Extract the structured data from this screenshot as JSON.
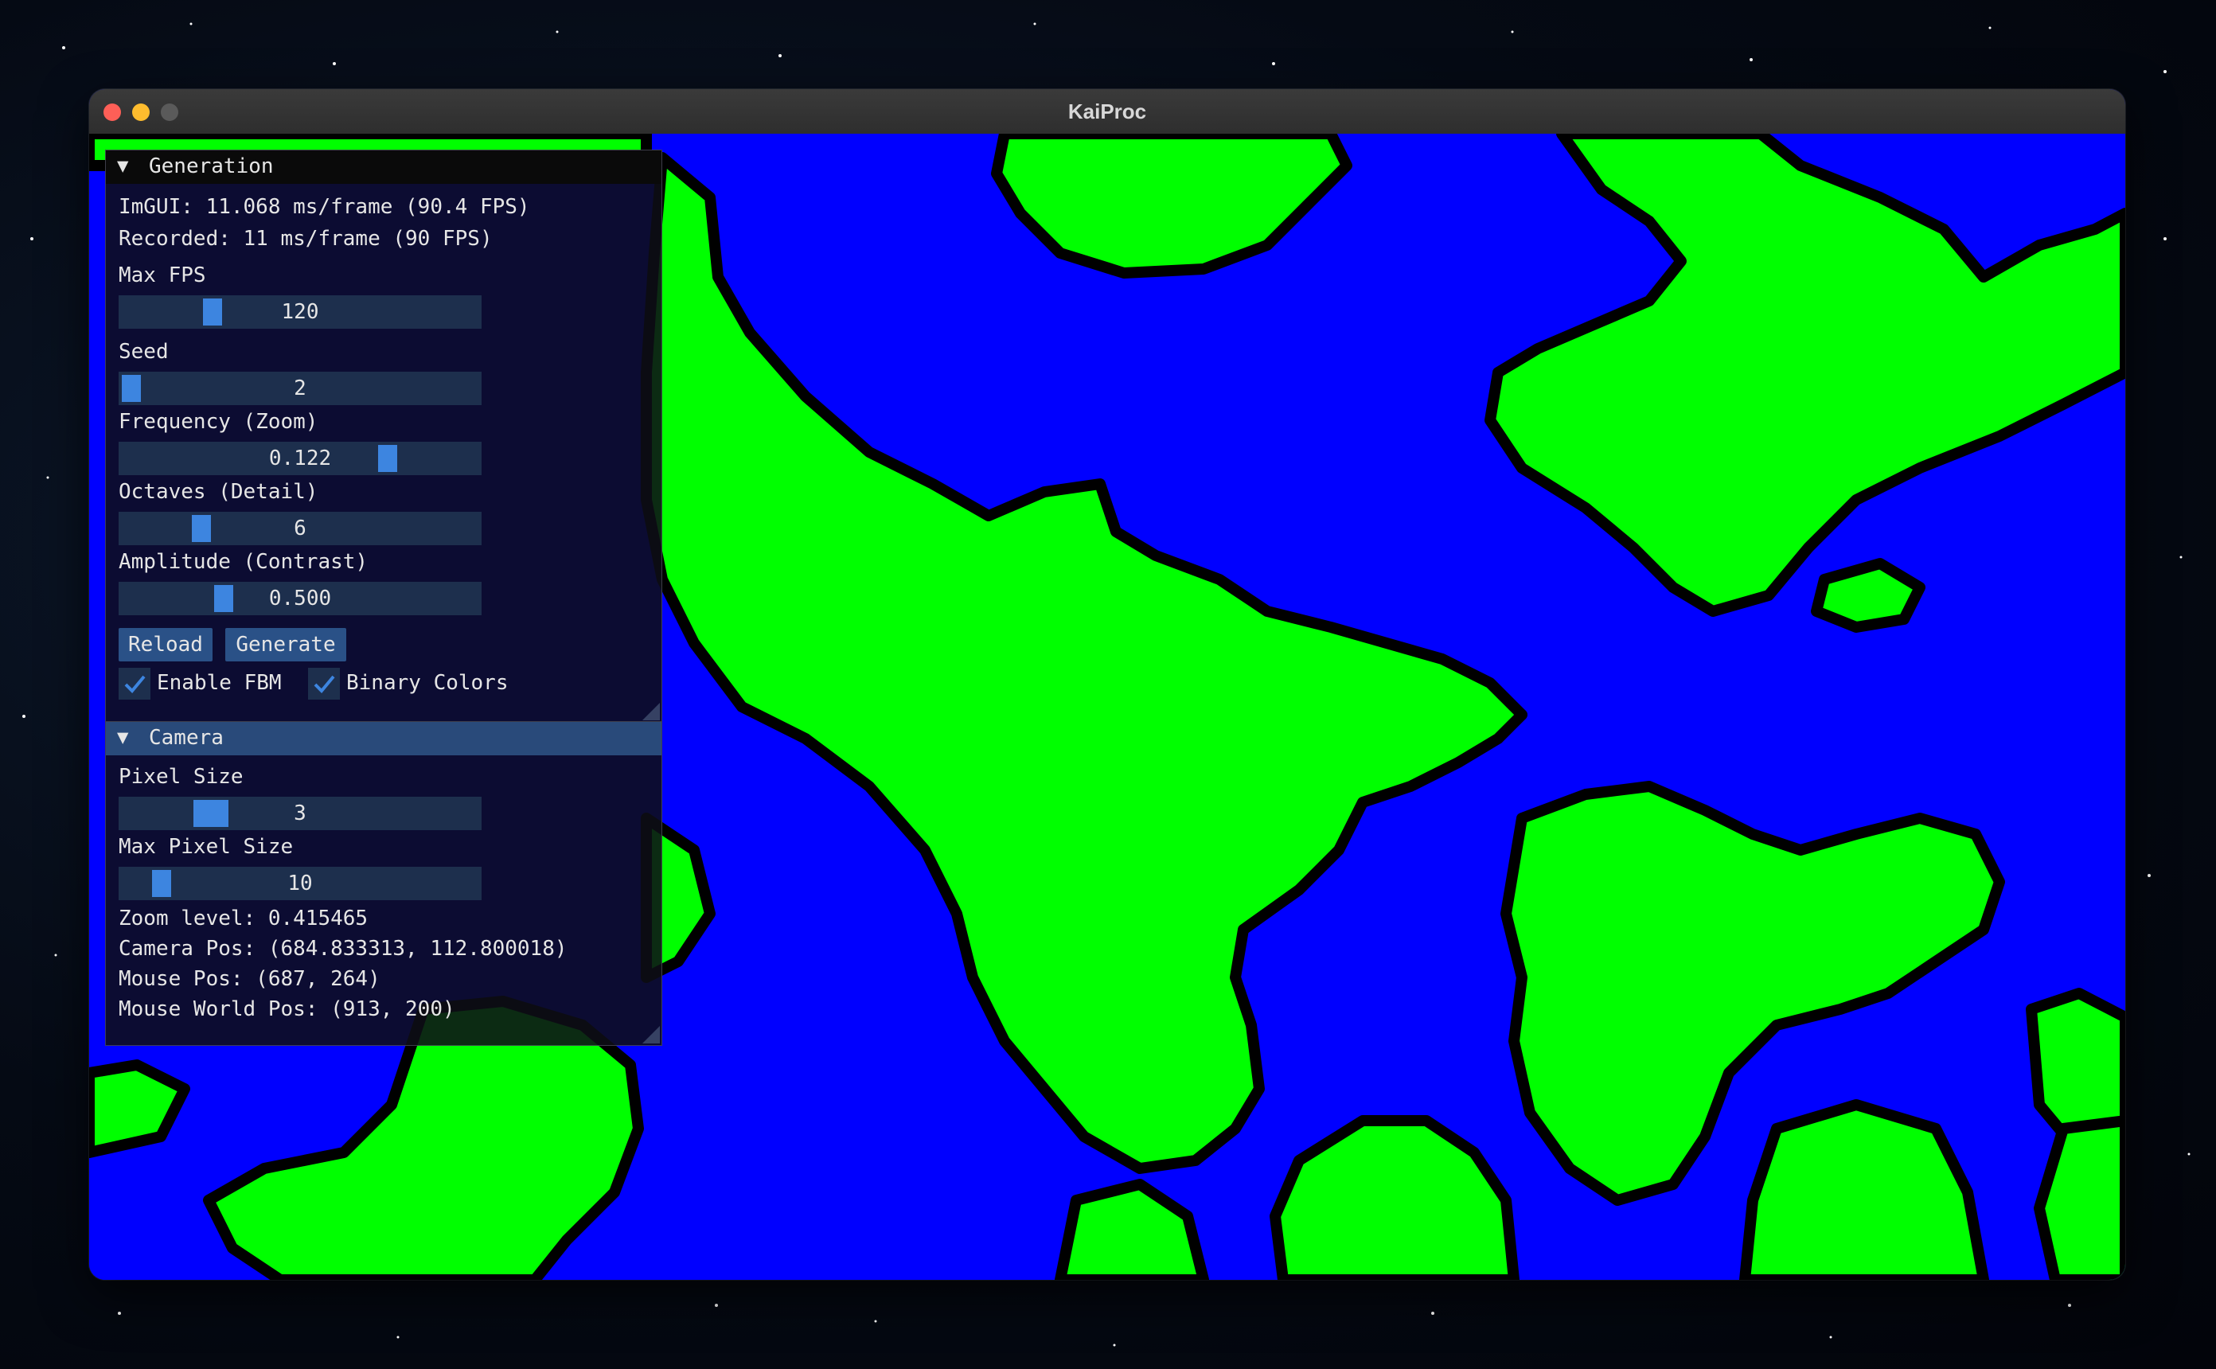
{
  "window": {
    "title": "KaiProc"
  },
  "generation": {
    "header": "Generation",
    "imgui_stat": "ImGUI: 11.068 ms/frame (90.4 FPS)",
    "recorded_stat": "Recorded: 11 ms/frame (90 FPS)",
    "max_fps": {
      "label": "Max FPS",
      "value": "120"
    },
    "seed": {
      "label": "Seed",
      "value": "2"
    },
    "frequency": {
      "label": "Frequency (Zoom)",
      "value": "0.122"
    },
    "octaves": {
      "label": "Octaves (Detail)",
      "value": "6"
    },
    "amplitude": {
      "label": "Amplitude (Contrast)",
      "value": "0.500"
    },
    "reload_label": "Reload",
    "generate_label": "Generate",
    "enable_fbm": {
      "label": "Enable FBM",
      "checked": true
    },
    "binary_colors": {
      "label": "Binary Colors",
      "checked": true
    }
  },
  "camera": {
    "header": "Camera",
    "pixel_size": {
      "label": "Pixel Size",
      "value": "3"
    },
    "max_pixel_size": {
      "label": "Max Pixel Size",
      "value": "10"
    },
    "zoom_level": "Zoom level: 0.415465",
    "camera_pos": "Camera Pos: (684.833313, 112.800018)",
    "mouse_pos": "Mouse Pos: (687, 264)",
    "mouse_world_pos": "Mouse World Pos: (913, 200)"
  },
  "colors": {
    "water": "#0000ff",
    "land": "#00ff00",
    "edge": "#000000",
    "accent": "#3d85e0"
  }
}
